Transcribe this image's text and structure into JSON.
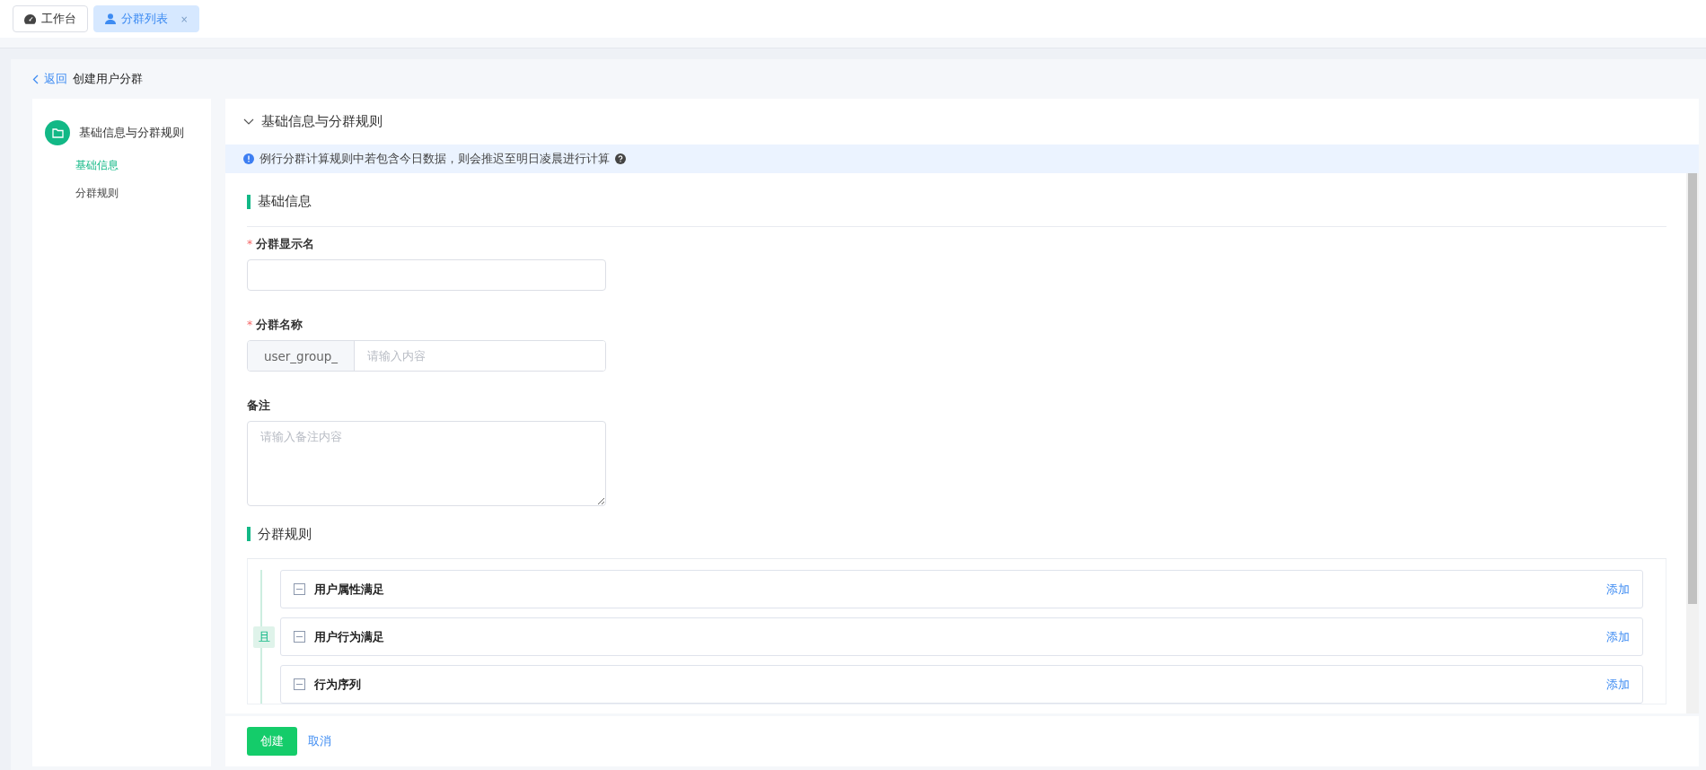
{
  "tabs": [
    {
      "label": "工作台",
      "selected": false
    },
    {
      "label": "分群列表",
      "selected": true,
      "close": "×"
    }
  ],
  "header": {
    "back": "返回",
    "title": "创建用户分群"
  },
  "steps": [
    {
      "label": "基础信息与分群规则",
      "children": [
        {
          "label": "基础信息",
          "selected": true
        },
        {
          "label": "分群规则",
          "selected": false
        }
      ]
    }
  ],
  "panel": {
    "title": "基础信息与分群规则",
    "expanded": true,
    "notice": "例行分群计算规则中若包含今日数据，则会推迟至明日凌晨进行计算",
    "basic": {
      "heading": "基础信息",
      "fields": [
        {
          "kind": "text",
          "label": "分群显示名",
          "required_mark": "*"
        },
        {
          "kind": "prefixed",
          "label": "分群名称",
          "required_mark": "*",
          "prefix": "user_group_",
          "placeholder": "请输入内容"
        },
        {
          "kind": "textarea",
          "label": "备注",
          "placeholder": "请输入备注内容"
        }
      ]
    },
    "rules": {
      "heading": "分群规则",
      "connector": "且",
      "items": [
        {
          "label": "用户属性满足",
          "action": "添加"
        },
        {
          "label": "用户行为满足",
          "action": "添加"
        },
        {
          "label": "行为序列",
          "action": "添加"
        }
      ]
    }
  },
  "footer": {
    "primary": "创建",
    "secondary": "取消"
  }
}
